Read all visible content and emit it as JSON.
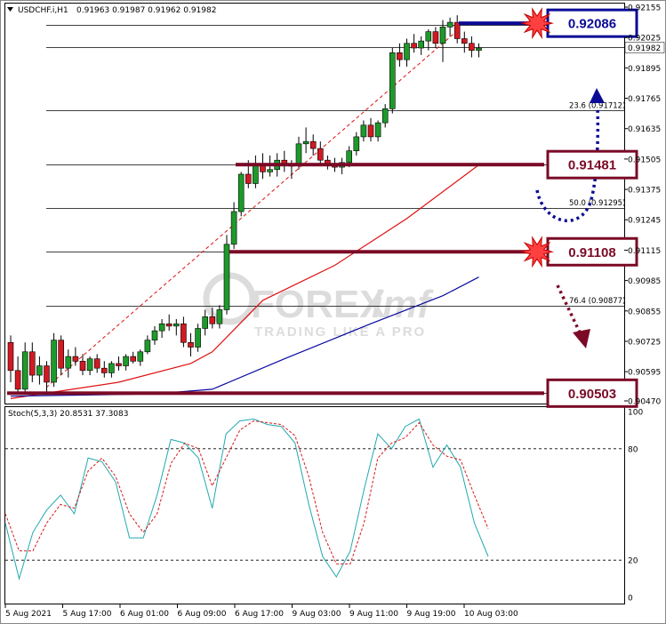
{
  "header": {
    "symbol": "USDCHF.i,H1",
    "ohlc": "0.91963 0.91987 0.91962 0.91982"
  },
  "watermark": {
    "brand_a": "FOREX",
    "brand_b": "imf",
    "tagline": "TRADING LIKE A PRO"
  },
  "oscillator_header": "Stoch(5,3,3) 20.8531 37.3083",
  "colors": {
    "bull": "#1e9a2a",
    "bear": "#d11a22",
    "ma_red": "#e01010",
    "ma_blue": "#0a0aa0",
    "stoch_main": "#20a8b0",
    "stoch_signal": "#d81818",
    "level_dark_red": "#7a0a26",
    "box_blue": "#0a0a96"
  },
  "chart_data": [
    {
      "type": "candlestick",
      "price_axis": {
        "labels": [
          "0.92155",
          "0.92025",
          "0.91895",
          "0.91765",
          "0.91635",
          "0.91505",
          "0.91375",
          "0.91245",
          "0.91115",
          "0.90985",
          "0.90855",
          "0.90725",
          "0.90595",
          "0.90470"
        ],
        "range": [
          0.9047,
          0.92155
        ],
        "current_price": "0.91982"
      },
      "time_axis": {
        "labels": [
          "5 Aug 2021",
          "5 Aug 17:00",
          "6 Aug 01:00",
          "6 Aug 09:00",
          "6 Aug 17:00",
          "9 Aug 03:00",
          "9 Aug 11:00",
          "9 Aug 19:00",
          "10 Aug 03:00"
        ]
      },
      "candles": [
        [
          0.9072,
          0.9075,
          0.9055,
          0.906
        ],
        [
          0.906,
          0.9066,
          0.905,
          0.9052
        ],
        [
          0.9052,
          0.9072,
          0.905,
          0.9068
        ],
        [
          0.9068,
          0.9072,
          0.9055,
          0.9058
        ],
        [
          0.9058,
          0.9066,
          0.9054,
          0.9062
        ],
        [
          0.9062,
          0.9064,
          0.905,
          0.9055
        ],
        [
          0.9055,
          0.9076,
          0.9053,
          0.9073
        ],
        [
          0.9073,
          0.9075,
          0.9058,
          0.9061
        ],
        [
          0.9061,
          0.9069,
          0.9057,
          0.9066
        ],
        [
          0.9066,
          0.907,
          0.9062,
          0.9064
        ],
        [
          0.9064,
          0.9067,
          0.9058,
          0.906
        ],
        [
          0.906,
          0.9066,
          0.9058,
          0.9065
        ],
        [
          0.9065,
          0.9067,
          0.9059,
          0.9061
        ],
        [
          0.9061,
          0.9064,
          0.9057,
          0.9059
        ],
        [
          0.9059,
          0.9064,
          0.9057,
          0.9063
        ],
        [
          0.9063,
          0.9066,
          0.906,
          0.9062
        ],
        [
          0.9062,
          0.9067,
          0.906,
          0.9066
        ],
        [
          0.9066,
          0.9068,
          0.9063,
          0.9064
        ],
        [
          0.9064,
          0.9069,
          0.9062,
          0.9068
        ],
        [
          0.9068,
          0.9075,
          0.9067,
          0.9073
        ],
        [
          0.9073,
          0.9079,
          0.9071,
          0.9077
        ],
        [
          0.9077,
          0.9082,
          0.9074,
          0.908
        ],
        [
          0.908,
          0.9084,
          0.9077,
          0.9079
        ],
        [
          0.9079,
          0.9082,
          0.9075,
          0.908
        ],
        [
          0.908,
          0.9083,
          0.907,
          0.9072
        ],
        [
          0.9072,
          0.9076,
          0.9066,
          0.907
        ],
        [
          0.907,
          0.908,
          0.9068,
          0.9078
        ],
        [
          0.9078,
          0.9086,
          0.9075,
          0.9083
        ],
        [
          0.9083,
          0.9087,
          0.9078,
          0.908
        ],
        [
          0.908,
          0.9088,
          0.9078,
          0.9086
        ],
        [
          0.9086,
          0.9118,
          0.9084,
          0.9114
        ],
        [
          0.9114,
          0.9132,
          0.9112,
          0.9128
        ],
        [
          0.9128,
          0.9145,
          0.9126,
          0.9144
        ],
        [
          0.9144,
          0.915,
          0.9138,
          0.914
        ],
        [
          0.914,
          0.9152,
          0.9138,
          0.9148
        ],
        [
          0.9148,
          0.9153,
          0.9142,
          0.9145
        ],
        [
          0.9145,
          0.9152,
          0.9143,
          0.9146
        ],
        [
          0.9146,
          0.9153,
          0.9143,
          0.915
        ],
        [
          0.915,
          0.9154,
          0.9145,
          0.9148
        ],
        [
          0.9148,
          0.915,
          0.9142,
          0.9148
        ],
        [
          0.9148,
          0.916,
          0.9146,
          0.9157
        ],
        [
          0.9157,
          0.9164,
          0.9153,
          0.9158
        ],
        [
          0.9158,
          0.9161,
          0.9152,
          0.9155
        ],
        [
          0.9155,
          0.9158,
          0.9148,
          0.915
        ],
        [
          0.915,
          0.9152,
          0.9146,
          0.9148
        ],
        [
          0.9148,
          0.9151,
          0.9145,
          0.9147
        ],
        [
          0.9147,
          0.9151,
          0.9144,
          0.9149
        ],
        [
          0.9149,
          0.9156,
          0.9147,
          0.9154
        ],
        [
          0.9154,
          0.9162,
          0.9152,
          0.916
        ],
        [
          0.916,
          0.9167,
          0.9158,
          0.9165
        ],
        [
          0.9165,
          0.9168,
          0.9158,
          0.916
        ],
        [
          0.916,
          0.9167,
          0.9158,
          0.9166
        ],
        [
          0.9166,
          0.9174,
          0.9164,
          0.9172
        ],
        [
          0.9172,
          0.9198,
          0.917,
          0.9196
        ],
        [
          0.9196,
          0.92,
          0.919,
          0.9193
        ],
        [
          0.9193,
          0.9202,
          0.919,
          0.92
        ],
        [
          0.92,
          0.9204,
          0.9196,
          0.9198
        ],
        [
          0.9198,
          0.9203,
          0.9195,
          0.9201
        ],
        [
          0.9201,
          0.9206,
          0.9197,
          0.9205
        ],
        [
          0.9205,
          0.9207,
          0.9198,
          0.92
        ],
        [
          0.92,
          0.921,
          0.9192,
          0.9207
        ],
        [
          0.9207,
          0.9211,
          0.9203,
          0.9209
        ],
        [
          0.9209,
          0.9212,
          0.92,
          0.9202
        ],
        [
          0.9202,
          0.9205,
          0.9196,
          0.92
        ],
        [
          0.92,
          0.9203,
          0.9194,
          0.9197
        ],
        [
          0.9197,
          0.92,
          0.9194,
          0.9198
        ]
      ],
      "moving_averages": [
        {
          "color": "#e01010",
          "values": [
            [
              0,
              0.9048
            ],
            [
              15,
              0.9055
            ],
            [
              25,
              0.9063
            ],
            [
              28,
              0.9068
            ],
            [
              35,
              0.909
            ],
            [
              45,
              0.9105
            ],
            [
              55,
              0.9125
            ],
            [
              65,
              0.9148
            ]
          ]
        },
        {
          "color": "#0a0aa0",
          "values": [
            [
              0,
              0.9049
            ],
            [
              20,
              0.905
            ],
            [
              28,
              0.9052
            ],
            [
              38,
              0.9065
            ],
            [
              50,
              0.908
            ],
            [
              60,
              0.9092
            ],
            [
              65,
              0.91
            ]
          ]
        }
      ],
      "fibonacci": [
        {
          "label": "23.6 (0.91712)",
          "price": 0.91712
        },
        {
          "label": "50.0 (0.91295)",
          "price": 0.91295
        },
        {
          "label": "76.4 (0.90877)",
          "price": 0.90877
        }
      ],
      "horizontal_lines": [
        0.9208,
        0.91982,
        0.91481,
        0.91108,
        0.90503
      ],
      "key_levels": [
        {
          "label": "0.92086",
          "price": 0.92086,
          "color": "#0a0a96",
          "starburst": true
        },
        {
          "label": "0.91481",
          "price": 0.91481,
          "color": "#7a0a26",
          "starburst": false
        },
        {
          "label": "0.91108",
          "price": 0.91108,
          "color": "#7a0a26",
          "starburst": true
        },
        {
          "label": "0.90503",
          "price": 0.90503,
          "color": "#7a0a26",
          "starburst": false
        }
      ]
    },
    {
      "type": "line",
      "name": "Stoch(5,3,3)",
      "y_axis_labels": [
        "100",
        "80",
        "20",
        "0"
      ],
      "ylim": [
        0,
        100
      ],
      "levels": [
        80,
        20
      ],
      "x_index_max": 65,
      "series": [
        {
          "color": "#20a8b0",
          "values": [
            [
              0,
              40
            ],
            [
              2,
              10
            ],
            [
              4,
              35
            ],
            [
              6,
              47
            ],
            [
              8,
              55
            ],
            [
              10,
              45
            ],
            [
              12,
              75
            ],
            [
              14,
              73
            ],
            [
              16,
              62
            ],
            [
              18,
              32
            ],
            [
              20,
              32
            ],
            [
              22,
              55
            ],
            [
              24,
              85
            ],
            [
              26,
              83
            ],
            [
              28,
              75
            ],
            [
              30,
              48
            ],
            [
              32,
              88
            ],
            [
              34,
              95
            ],
            [
              36,
              96
            ],
            [
              38,
              93
            ],
            [
              40,
              92
            ],
            [
              42,
              83
            ],
            [
              44,
              50
            ],
            [
              46,
              22
            ],
            [
              48,
              11
            ],
            [
              50,
              25
            ],
            [
              52,
              58
            ],
            [
              54,
              88
            ],
            [
              56,
              80
            ],
            [
              58,
              92
            ],
            [
              60,
              96
            ],
            [
              62,
              70
            ],
            [
              64,
              82
            ],
            [
              66,
              70
            ],
            [
              68,
              40
            ],
            [
              70,
              22
            ]
          ]
        },
        {
          "color": "#d81818",
          "values": [
            [
              0,
              45
            ],
            [
              2,
              25
            ],
            [
              4,
              25
            ],
            [
              6,
              40
            ],
            [
              8,
              50
            ],
            [
              10,
              48
            ],
            [
              12,
              68
            ],
            [
              14,
              75
            ],
            [
              16,
              65
            ],
            [
              18,
              45
            ],
            [
              20,
              35
            ],
            [
              22,
              45
            ],
            [
              24,
              72
            ],
            [
              26,
              83
            ],
            [
              28,
              80
            ],
            [
              30,
              60
            ],
            [
              32,
              75
            ],
            [
              34,
              90
            ],
            [
              36,
              95
            ],
            [
              38,
              94
            ],
            [
              40,
              93
            ],
            [
              42,
              87
            ],
            [
              44,
              65
            ],
            [
              46,
              35
            ],
            [
              48,
              18
            ],
            [
              50,
              18
            ],
            [
              52,
              40
            ],
            [
              54,
              75
            ],
            [
              56,
              83
            ],
            [
              58,
              86
            ],
            [
              60,
              94
            ],
            [
              62,
              82
            ],
            [
              64,
              76
            ],
            [
              66,
              74
            ],
            [
              68,
              55
            ],
            [
              70,
              37
            ]
          ]
        }
      ]
    }
  ]
}
